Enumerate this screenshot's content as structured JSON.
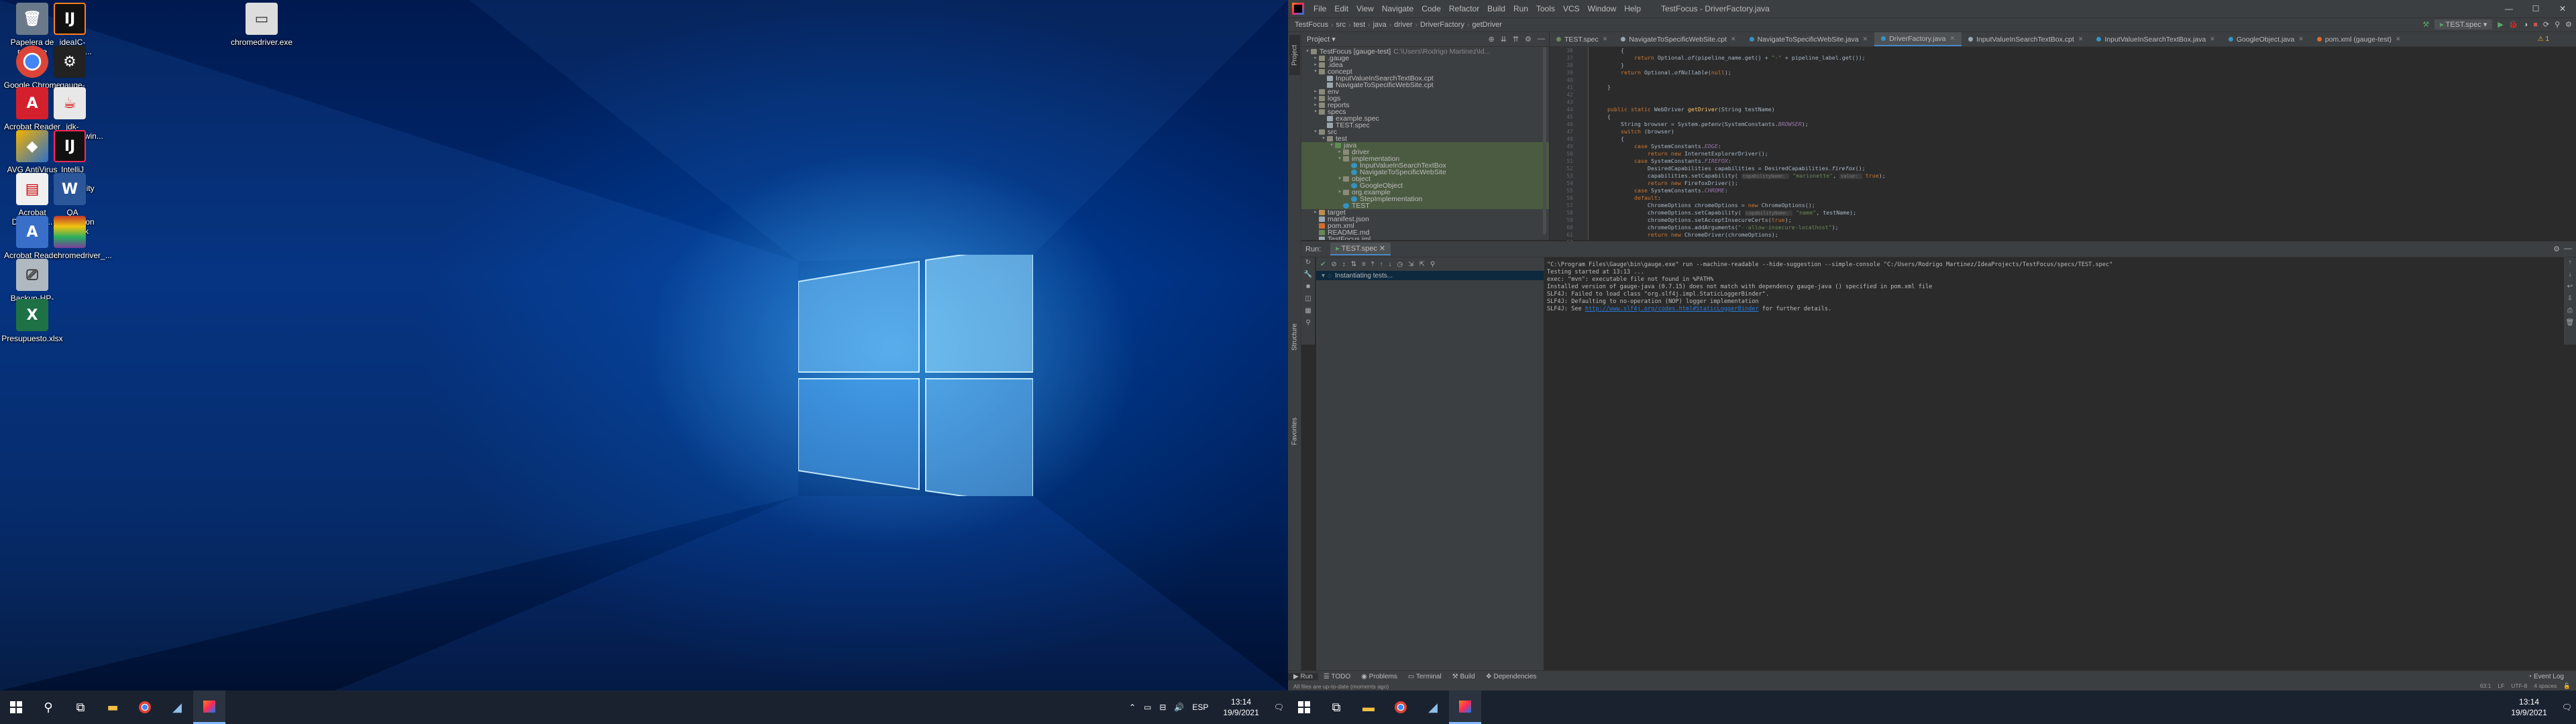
{
  "desktop": {
    "icons": [
      {
        "label": "Papelera de reciclaje",
        "glyph": "🗑",
        "color": "#6a7a8a"
      },
      {
        "label": "ideaIC-2021.2.2...",
        "glyph": "IJ",
        "color": "#111111"
      },
      {
        "label": "chromedriver.exe",
        "glyph": "▭",
        "color": "#dddddd"
      },
      {
        "label": "Google Chrome",
        "glyph": "◉",
        "color": "#dd4b39"
      },
      {
        "label": "gauge-1.4.1-wind...",
        "glyph": "⚙",
        "color": "#222222"
      },
      {
        "label": "Acrobat Reader DC",
        "glyph": "A",
        "color": "#d4202c"
      },
      {
        "label": "jdk-11.0.12_win...",
        "glyph": "☕",
        "color": "#e8e8e8"
      },
      {
        "label": "AVG AntiVirus FREE",
        "glyph": "◆",
        "color": "#2e6fc7"
      },
      {
        "label": "IntelliJ IDEA Community E...",
        "glyph": "IJ",
        "color": "#111111"
      },
      {
        "label": "Acrobat Distributo...",
        "glyph": "▤",
        "color": "#f0f0f0"
      },
      {
        "label": "QA Automation Testbook",
        "glyph": "W",
        "color": "#2b579a"
      },
      {
        "label": "Acrobat Reader setup",
        "glyph": "A",
        "color": "#3a6fc9"
      },
      {
        "label": "chromedriver_...",
        "glyph": "▦",
        "color": "#7a3c9c"
      },
      {
        "label": "Backup-HP-game...",
        "glyph": "⎚",
        "color": "#b0b8c0"
      },
      {
        "label": "Presupuesto.xlsx",
        "glyph": "X",
        "color": "#1e7145"
      }
    ]
  },
  "taskbar_left": {
    "start_icon": "windows-logo-icon",
    "apps": [
      "search-icon",
      "task-view-icon",
      "file-explorer-icon",
      "chrome-icon",
      "app-icon",
      "intellij-icon"
    ],
    "tray": {
      "lang": "ESP",
      "time": "13:14",
      "date": "19/9/2021"
    }
  },
  "ide": {
    "menu": [
      "File",
      "Edit",
      "View",
      "Navigate",
      "Code",
      "Refactor",
      "Build",
      "Run",
      "Tools",
      "VCS",
      "Window",
      "Help"
    ],
    "title": "TestFocus - DriverFactory.java",
    "breadcrumbs": [
      "TestFocus",
      "src",
      "test",
      "java",
      "driver",
      "DriverFactory",
      "getDriver"
    ],
    "run_config": "TEST.spec",
    "project_panel": {
      "title": "Project",
      "rows": [
        {
          "indent": 0,
          "arrow": "▾",
          "icon": "folder",
          "text": "TestFocus [gauge-test]",
          "muted": "C:\\Users\\Rodrigo Martinez\\Id..."
        },
        {
          "indent": 1,
          "arrow": "▸",
          "icon": "folder",
          "text": ".gauge",
          "muted": ""
        },
        {
          "indent": 1,
          "arrow": "▸",
          "icon": "folder",
          "text": ".idea",
          "muted": ""
        },
        {
          "indent": 1,
          "arrow": "▾",
          "icon": "folder",
          "text": "concept",
          "muted": ""
        },
        {
          "indent": 2,
          "arrow": "",
          "icon": "file",
          "text": "InputValueInSearchTextBox.cpt",
          "muted": ""
        },
        {
          "indent": 2,
          "arrow": "",
          "icon": "file",
          "text": "NavigateToSpecificWebSite.cpt",
          "muted": ""
        },
        {
          "indent": 1,
          "arrow": "▸",
          "icon": "folder",
          "text": "env",
          "muted": ""
        },
        {
          "indent": 1,
          "arrow": "▸",
          "icon": "folder",
          "text": "logs",
          "muted": ""
        },
        {
          "indent": 1,
          "arrow": "▸",
          "icon": "folder",
          "text": "reports",
          "muted": ""
        },
        {
          "indent": 1,
          "arrow": "▾",
          "icon": "folder",
          "text": "specs",
          "muted": ""
        },
        {
          "indent": 2,
          "arrow": "",
          "icon": "file",
          "text": "example.spec",
          "muted": ""
        },
        {
          "indent": 2,
          "arrow": "",
          "icon": "file",
          "text": "TEST.spec",
          "muted": ""
        },
        {
          "indent": 1,
          "arrow": "▾",
          "icon": "folder",
          "text": "src",
          "muted": ""
        },
        {
          "indent": 2,
          "arrow": "▾",
          "icon": "folder",
          "text": "test",
          "muted": ""
        },
        {
          "indent": 3,
          "arrow": "▾",
          "icon": "folder-test",
          "text": "java",
          "muted": "",
          "hl": true
        },
        {
          "indent": 4,
          "arrow": "▸",
          "icon": "folder",
          "text": "driver",
          "muted": "",
          "hl": true
        },
        {
          "indent": 4,
          "arrow": "▾",
          "icon": "folder",
          "text": "implementation",
          "muted": "",
          "hl": true
        },
        {
          "indent": 5,
          "arrow": "",
          "icon": "cls",
          "text": "InputValueInSearchTextBox",
          "muted": "",
          "hl": true
        },
        {
          "indent": 5,
          "arrow": "",
          "icon": "cls",
          "text": "NavigateToSpecificWebSite",
          "muted": "",
          "hl": true
        },
        {
          "indent": 4,
          "arrow": "▾",
          "icon": "folder",
          "text": "object",
          "muted": "",
          "hl": true
        },
        {
          "indent": 5,
          "arrow": "",
          "icon": "cls",
          "text": "GoogleObject",
          "muted": "",
          "hl": true
        },
        {
          "indent": 4,
          "arrow": "▾",
          "icon": "folder",
          "text": "org.example",
          "muted": "",
          "hl": true
        },
        {
          "indent": 5,
          "arrow": "",
          "icon": "cls",
          "text": "StepImplementation",
          "muted": "",
          "hl": true
        },
        {
          "indent": 4,
          "arrow": "",
          "icon": "cls",
          "text": "TEST",
          "muted": "",
          "hl": true
        },
        {
          "indent": 1,
          "arrow": "▸",
          "icon": "folder-ex",
          "text": "target",
          "muted": ""
        },
        {
          "indent": 1,
          "arrow": "",
          "icon": "file",
          "text": "manifest.json",
          "muted": ""
        },
        {
          "indent": 1,
          "arrow": "",
          "icon": "xml",
          "text": "pom.xml",
          "muted": ""
        },
        {
          "indent": 1,
          "arrow": "",
          "icon": "md",
          "text": "README.md",
          "muted": ""
        },
        {
          "indent": 1,
          "arrow": "",
          "icon": "file",
          "text": "TestFocus.iml",
          "muted": ""
        },
        {
          "indent": 0,
          "arrow": "▾",
          "icon": "folder",
          "text": "External Libraries",
          "muted": ""
        },
        {
          "indent": 1,
          "arrow": "▸",
          "icon": "folder",
          "text": "< 11 >",
          "muted": "C:\\Program Files\\Java\\jdk-11.0.12"
        },
        {
          "indent": 1,
          "arrow": "▸",
          "icon": "folder",
          "text": "Maven: com.codeborne:selenide:5.1.1",
          "muted": ""
        }
      ]
    },
    "tabs": [
      {
        "label": "TEST.spec",
        "color": "#6a8759",
        "active": false
      },
      {
        "label": "NavigateToSpecificWebSite.cpt",
        "color": "#9aa7b0",
        "active": false
      },
      {
        "label": "NavigateToSpecificWebSite.java",
        "color": "#3592c4",
        "active": false
      },
      {
        "label": "DriverFactory.java",
        "color": "#3592c4",
        "active": true
      },
      {
        "label": "InputValueInSearchTextBox.cpt",
        "color": "#9aa7b0",
        "active": false
      },
      {
        "label": "InputValueInSearchTextBox.java",
        "color": "#3592c4",
        "active": false
      },
      {
        "label": "GoogleObject.java",
        "color": "#3592c4",
        "active": false
      },
      {
        "label": "pom.xml (gauge-test)",
        "color": "#d46d2c",
        "active": false
      }
    ],
    "warning_count": "1",
    "code": {
      "first_line": 36,
      "current_line": 63,
      "lines": [
        [
          [
            "        ",
            ""
          ],
          [
            "{",
            ""
          ]
        ],
        [
          [
            "            ",
            ""
          ],
          [
            "return ",
            "kw"
          ],
          [
            "Optional.",
            ""
          ],
          [
            "of",
            "it"
          ],
          [
            "(pipeline_name.get() + ",
            ""
          ],
          [
            "\"-\"",
            "st"
          ],
          [
            " + pipeline_label.get());",
            ""
          ]
        ],
        [
          [
            "        }",
            ""
          ]
        ],
        [
          [
            "        ",
            ""
          ],
          [
            "return ",
            "kw"
          ],
          [
            "Optional.",
            ""
          ],
          [
            "ofNullable",
            "it"
          ],
          [
            "(",
            ""
          ],
          [
            "null",
            "kw"
          ],
          [
            ");",
            ""
          ]
        ],
        [
          [
            "",
            ""
          ]
        ],
        [
          [
            "    }",
            ""
          ]
        ],
        [
          [
            "",
            ""
          ]
        ],
        [
          [
            "",
            ""
          ]
        ],
        [
          [
            "    ",
            ""
          ],
          [
            "public static ",
            "kw"
          ],
          [
            "WebDriver ",
            ""
          ],
          [
            "getDriver",
            "fn"
          ],
          [
            "(String testName)",
            ""
          ]
        ],
        [
          [
            "    {",
            ""
          ]
        ],
        [
          [
            "        String browser = System.",
            ""
          ],
          [
            "getenv",
            "it"
          ],
          [
            "(SystemConstants.",
            ""
          ],
          [
            "BROWSER",
            "cn"
          ],
          [
            ");",
            ""
          ]
        ],
        [
          [
            "        ",
            ""
          ],
          [
            "switch ",
            "kw"
          ],
          [
            "(browser)",
            ""
          ]
        ],
        [
          [
            "        {",
            ""
          ]
        ],
        [
          [
            "            ",
            ""
          ],
          [
            "case ",
            "kw"
          ],
          [
            "SystemConstants.",
            ""
          ],
          [
            "EDGE",
            "cn"
          ],
          [
            ":",
            ""
          ]
        ],
        [
          [
            "                ",
            ""
          ],
          [
            "return new ",
            "kw"
          ],
          [
            "InternetExplorerDriver();",
            ""
          ]
        ],
        [
          [
            "            ",
            ""
          ],
          [
            "case ",
            "kw"
          ],
          [
            "SystemConstants.",
            ""
          ],
          [
            "FIREFOX",
            "cn"
          ],
          [
            ":",
            ""
          ]
        ],
        [
          [
            "                DesiredCapabilities capabilities = DesiredCapabilities.",
            ""
          ],
          [
            "firefox",
            "it"
          ],
          [
            "();",
            ""
          ]
        ],
        [
          [
            "                capabilities.setCapability( ",
            ""
          ],
          [
            "capabilityName: ",
            "hint"
          ],
          [
            " ",
            ""
          ],
          [
            "\"marionette\"",
            "st"
          ],
          [
            ", ",
            ""
          ],
          [
            "value: ",
            "hint"
          ],
          [
            " ",
            ""
          ],
          [
            "true",
            "kw"
          ],
          [
            ");",
            ""
          ]
        ],
        [
          [
            "                ",
            ""
          ],
          [
            "return new ",
            "kw"
          ],
          [
            "FirefoxDriver();",
            ""
          ]
        ],
        [
          [
            "            ",
            ""
          ],
          [
            "case ",
            "kw"
          ],
          [
            "SystemConstants.",
            ""
          ],
          [
            "CHROME",
            "cn"
          ],
          [
            ":",
            ""
          ]
        ],
        [
          [
            "            ",
            ""
          ],
          [
            "default",
            "kw"
          ],
          [
            ":",
            ""
          ]
        ],
        [
          [
            "                ChromeOptions chromeOptions = ",
            ""
          ],
          [
            "new ",
            "kw"
          ],
          [
            "ChromeOptions();",
            ""
          ]
        ],
        [
          [
            "                chromeOptions.setCapability( ",
            ""
          ],
          [
            "capabilityName: ",
            "hint"
          ],
          [
            " ",
            ""
          ],
          [
            "\"name\"",
            "st"
          ],
          [
            ", testName);",
            ""
          ]
        ],
        [
          [
            "                chromeOptions.setAcceptInsecureCerts(",
            ""
          ],
          [
            "true",
            "kw"
          ],
          [
            ");",
            ""
          ]
        ],
        [
          [
            "                chromeOptions.addArguments(",
            ""
          ],
          [
            "\"--allow-insecure-localhost\"",
            "st"
          ],
          [
            ");",
            ""
          ]
        ],
        [
          [
            "                ",
            ""
          ],
          [
            "return new ",
            "kw"
          ],
          [
            "ChromeDriver(chromeOptions);",
            ""
          ]
        ],
        [
          [
            "        }",
            ""
          ]
        ],
        [
          [
            "    }",
            ""
          ]
        ],
        [
          [
            "}",
            ""
          ]
        ]
      ]
    },
    "run_panel": {
      "title": "Run:",
      "tab": "TEST.spec",
      "tree_item": "Instantiating tests...",
      "console": [
        "\"C:\\Program Files\\Gauge\\bin\\gauge.exe\" run --machine-readable --hide-suggestion --simple-console \"C:/Users/Rodrigo Martinez/IdeaProjects/TestFocus/specs/TEST.spec\"",
        "Testing started at 13:13 ...",
        "exec: \"mvn\": executable file not found in %PATH%",
        "Installed version of gauge-java (0.7.15) does not match with dependency gauge-java () specified in pom.xml file",
        "SLF4J: Failed to load class \"org.slf4j.impl.StaticLoggerBinder\".",
        "SLF4J: Defaulting to no-operation (NOP) logger implementation"
      ],
      "console_last_prefix": "SLF4J: See ",
      "console_link": "http://www.slf4j.org/codes.html#StaticLoggerBinder",
      "console_last_suffix": " for further details."
    },
    "bottom_tools": [
      "Run",
      "TODO",
      "Problems",
      "Terminal",
      "Build",
      "Dependencies"
    ],
    "event_log": "Event Log",
    "status_left": "All files are up-to-date (moments ago)",
    "status_right": [
      "63:1",
      "LF",
      "UTF-8",
      "4 spaces"
    ],
    "left_vtabs": [
      "Project",
      "Structure",
      "Favorites"
    ]
  },
  "taskbar_right": {
    "apps": [
      "file-explorer-icon",
      "chrome-icon",
      "app-icon",
      "intellij-icon"
    ],
    "time": "13:14",
    "date": "19/9/2021"
  }
}
